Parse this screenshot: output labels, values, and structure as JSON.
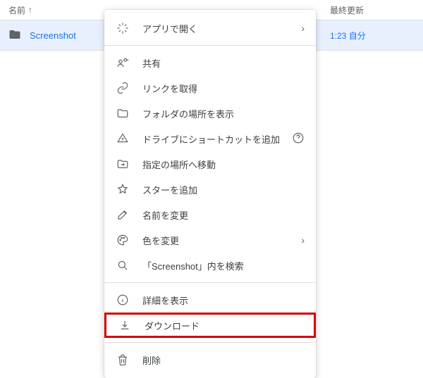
{
  "header": {
    "name_label": "名前",
    "updated_label": "最終更新"
  },
  "row": {
    "name": "Screenshot",
    "updated": "1:23 自分"
  },
  "menu": {
    "open_with": "アプリで開く",
    "share": "共有",
    "get_link": "リンクを取得",
    "show_location": "フォルダの場所を表示",
    "add_shortcut": "ドライブにショートカットを追加",
    "move_to": "指定の場所へ移動",
    "add_star": "スターを追加",
    "rename": "名前を変更",
    "change_color": "色を変更",
    "search_within": "「Screenshot」内を検索",
    "view_details": "詳細を表示",
    "download": "ダウンロード",
    "remove": "削除"
  }
}
